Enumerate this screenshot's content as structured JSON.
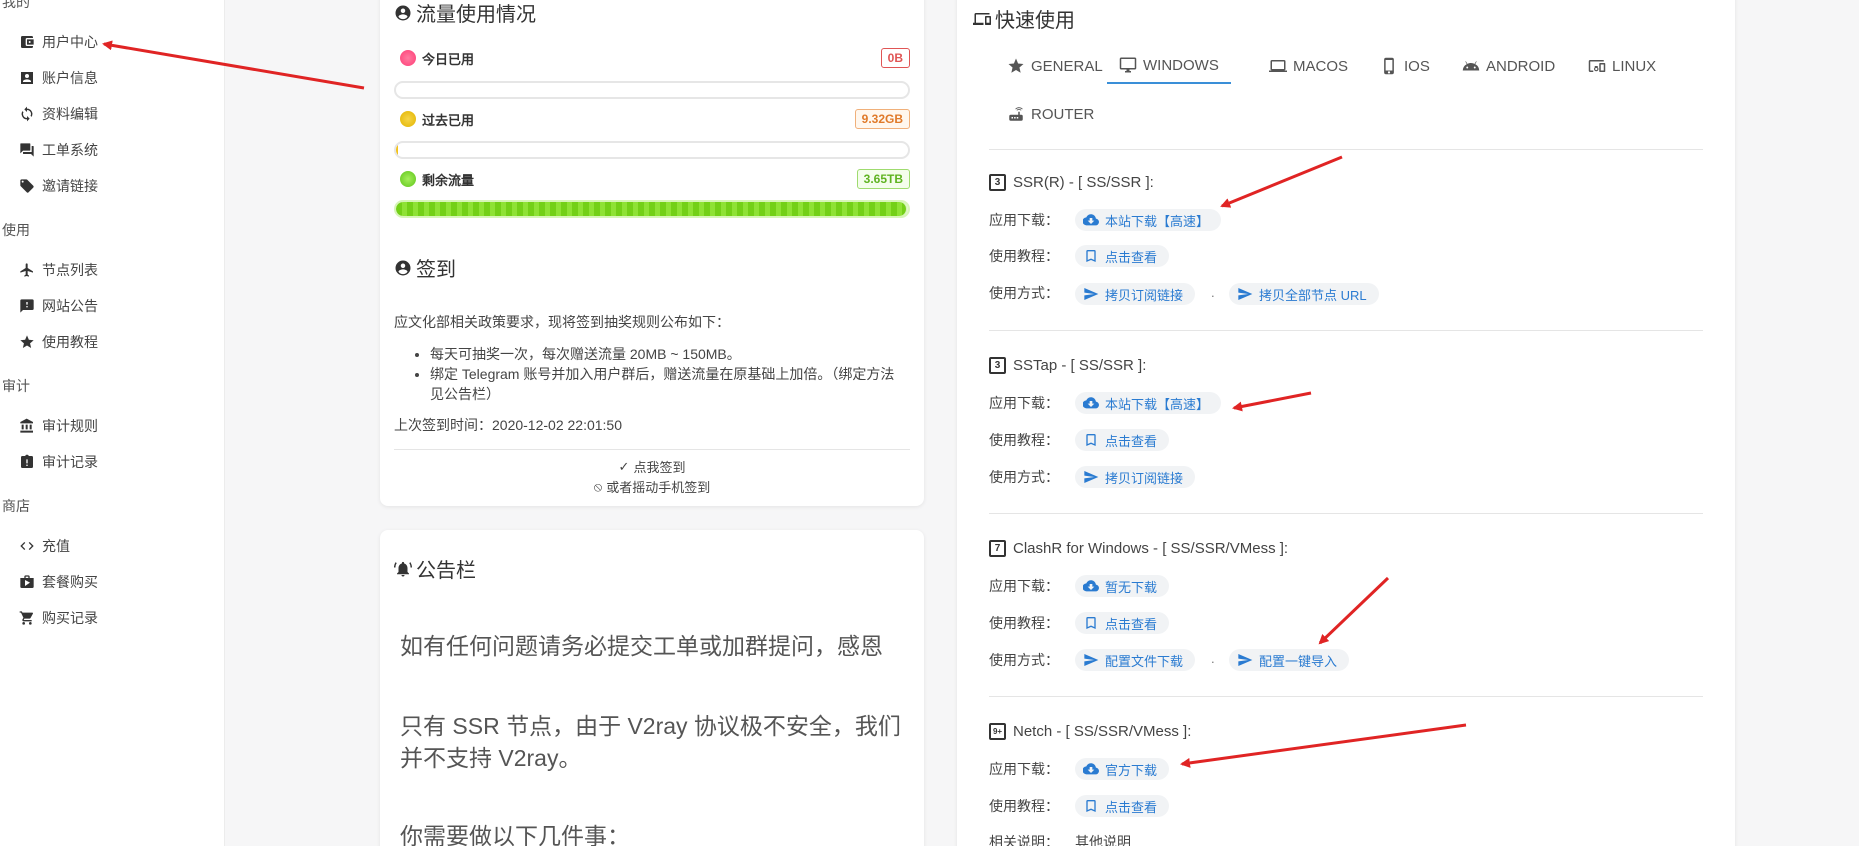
{
  "sidebar": {
    "sections": [
      {
        "title": "我的"
      },
      {
        "title": "使用"
      },
      {
        "title": "审计"
      },
      {
        "title": "商店"
      }
    ],
    "items": [
      {
        "label": "用户中心",
        "icon": "wallet-icon"
      },
      {
        "label": "账户信息",
        "icon": "user-card-icon"
      },
      {
        "label": "资料编辑",
        "icon": "sync-icon"
      },
      {
        "label": "工单系统",
        "icon": "chat-icon"
      },
      {
        "label": "邀请链接",
        "icon": "tag-icon"
      },
      {
        "label": "节点列表",
        "icon": "plane-icon"
      },
      {
        "label": "网站公告",
        "icon": "alert-icon"
      },
      {
        "label": "使用教程",
        "icon": "star-icon"
      },
      {
        "label": "审计规则",
        "icon": "bank-icon"
      },
      {
        "label": "审计记录",
        "icon": "clipboard-alert-icon"
      },
      {
        "label": "充值",
        "icon": "code-icon"
      },
      {
        "label": "套餐购买",
        "icon": "shopping-bag-icon"
      },
      {
        "label": "购买记录",
        "icon": "cart-icon"
      }
    ]
  },
  "traffic": {
    "title": "流量使用情况",
    "rows": [
      {
        "label": "今日已用",
        "value": "0B",
        "dot_color": "#ff5c8a",
        "badge_color": "#e05555",
        "fill": 0.0
      },
      {
        "label": "过去已用",
        "value": "9.32GB",
        "dot_color": "#f2c21b",
        "badge_color": "#e07a2a",
        "fill": 0.003
      },
      {
        "label": "剩余流量",
        "value": "3.65TB",
        "dot_color": "#7ad02a",
        "badge_color": "#5fb321",
        "fill": 0.997
      }
    ]
  },
  "checkin": {
    "title": "签到",
    "intro": "应文化部相关政策要求，现将签到抽奖规则公布如下：",
    "rules": [
      "每天可抽奖一次，每次赠送流量 20MB ~ 150MB。",
      "绑定 Telegram 账号并加入用户群后，赠送流量在原基础上加倍。（绑定方法见公告栏）"
    ],
    "last_checkin": "上次签到时间：2020-12-02 22:01:50",
    "button_label": "点我签到",
    "shake_label": "或者摇动手机签到"
  },
  "announcement": {
    "title": "公告栏",
    "paragraphs": [
      "如有任何问题请务必提交工单或加群提问，感恩",
      "只有 SSR 节点，由于 V2ray 协议极不安全，我们并不支持 V2ray。",
      "你需要做以下几件事："
    ]
  },
  "quick": {
    "title": "快速使用",
    "tabs": [
      {
        "label": "GENERAL",
        "icon": "star-icon"
      },
      {
        "label": "WINDOWS",
        "icon": "monitor-icon",
        "active": true
      },
      {
        "label": "MACOS",
        "icon": "laptop-icon"
      },
      {
        "label": "IOS",
        "icon": "phone-icon"
      },
      {
        "label": "ANDROID",
        "icon": "android-icon"
      },
      {
        "label": "LINUX",
        "icon": "devices-icon"
      },
      {
        "label": "ROUTER",
        "icon": "router-icon"
      }
    ],
    "labels": {
      "download": "应用下载：",
      "tutorial": "使用教程：",
      "usage": "使用方式：",
      "related": "相关说明："
    },
    "sections": [
      {
        "num": "3",
        "title": "SSR(R) - [ SS/SSR ]:",
        "download": "本站下载【高速】",
        "tutorial": "点击查看",
        "usage": [
          "拷贝订阅链接",
          "拷贝全部节点 URL"
        ]
      },
      {
        "num": "3",
        "title": "SSTap - [ SS/SSR ]:",
        "download": "本站下载【高速】",
        "tutorial": "点击查看",
        "usage": [
          "拷贝订阅链接"
        ]
      },
      {
        "num": "7",
        "title": "ClashR for Windows - [ SS/SSR/VMess ]:",
        "download": "暂无下载",
        "tutorial": "点击查看",
        "usage": [
          "配置文件下载",
          "配置一键导入"
        ]
      },
      {
        "num": "9+",
        "title": "Netch - [ SS/SSR/VMess ]:",
        "download": "官方下载",
        "tutorial": "点击查看",
        "related": "其他说明"
      }
    ],
    "separator": "."
  },
  "colors": {
    "accent": "#2a7bd1",
    "arrow": "#e02424",
    "tab_underline": "#3a8fd8"
  }
}
